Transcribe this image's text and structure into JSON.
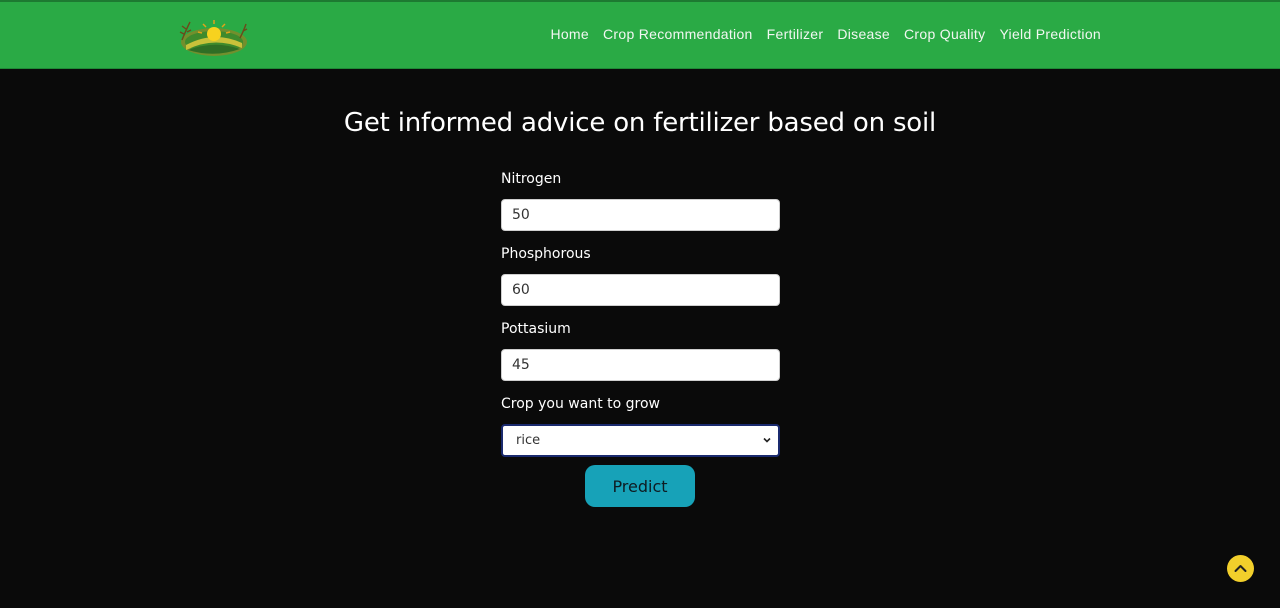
{
  "nav": {
    "items": [
      {
        "label": "Home"
      },
      {
        "label": "Crop Recommendation"
      },
      {
        "label": "Fertilizer"
      },
      {
        "label": "Disease"
      },
      {
        "label": "Crop Quality"
      },
      {
        "label": "Yield Prediction"
      }
    ]
  },
  "logo": {
    "icon": "farm-sun-logo-icon"
  },
  "page": {
    "heading": "Get informed advice on fertilizer based on soil"
  },
  "form": {
    "nitrogen": {
      "label": "Nitrogen",
      "value": "50"
    },
    "phosphorous": {
      "label": "Phosphorous",
      "value": "60"
    },
    "pottasium": {
      "label": "Pottasium",
      "value": "45"
    },
    "crop": {
      "label": "Crop you want to grow",
      "selected": "rice"
    },
    "submit_label": "Predict"
  },
  "scroll_top": {
    "icon": "chevron-up-icon"
  },
  "colors": {
    "header_bg": "#2aaa45",
    "page_bg": "#0a0a0a",
    "button_bg": "#17a2b8",
    "scroll_top_bg": "#f2cf2b"
  }
}
